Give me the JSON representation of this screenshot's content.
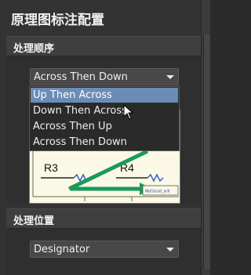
{
  "title": "原理图标注配置",
  "sections": {
    "order": {
      "header": "处理顺序",
      "dropdown_value": "Across Then Down",
      "menu_options": [
        "Up Then Across",
        "Down Then Across",
        "Across Then Up",
        "Across Then Down"
      ],
      "highlighted_option": "Up Then Across",
      "preview": {
        "labels": [
          "R3",
          "R4"
        ],
        "footer_text": "MyCircuit_sch"
      }
    },
    "location": {
      "header": "处理位置",
      "dropdown_value": "Designator"
    }
  },
  "colors": {
    "panel_bg": "#333333",
    "highlight": "#6b8db5",
    "arrow_green": "#1a9a5c",
    "preview_bg": "#fbf8e6"
  },
  "icons": [
    "chevron-down-icon",
    "mouse-cursor-icon",
    "green-arrow-icon"
  ]
}
